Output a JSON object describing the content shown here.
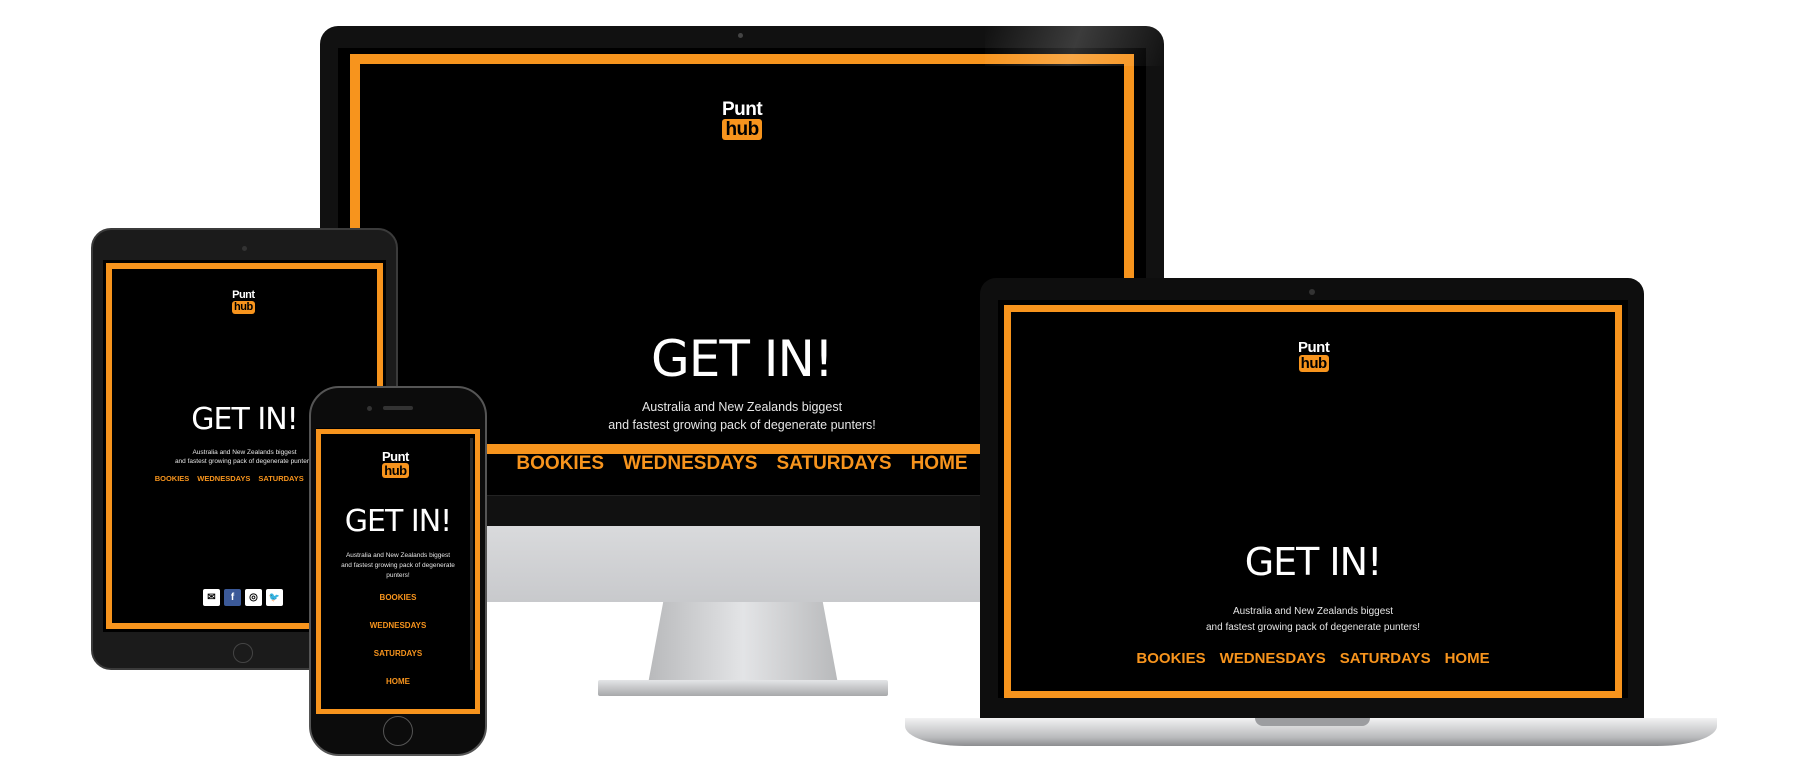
{
  "brand": {
    "logo_top": "Punt",
    "logo_bottom": "hub",
    "accent_color": "#f7941d"
  },
  "hero": {
    "headline": "GET IN!",
    "tagline_line1": "Australia and New Zealands biggest",
    "tagline_line2": "and fastest growing pack of degenerate punters!",
    "phone_tagline_line1": "Australia and New Zealands biggest",
    "phone_tagline_line2": "and fastest growing pack of degenerate",
    "phone_tagline_line3": "punters!"
  },
  "nav": {
    "bookies": "BOOKIES",
    "wednesdays": "WEDNESDAYS",
    "saturdays": "SATURDAYS",
    "home": "HOME"
  },
  "social": {
    "icons": [
      "email-icon",
      "facebook-icon",
      "instagram-icon",
      "twitter-icon"
    ],
    "email_glyph": "✉",
    "facebook_glyph": "f",
    "instagram_glyph": "◎",
    "twitter_glyph": "🐦"
  },
  "devices": [
    "imac",
    "macbook",
    "ipad",
    "iphone"
  ],
  "apple_glyph": ""
}
